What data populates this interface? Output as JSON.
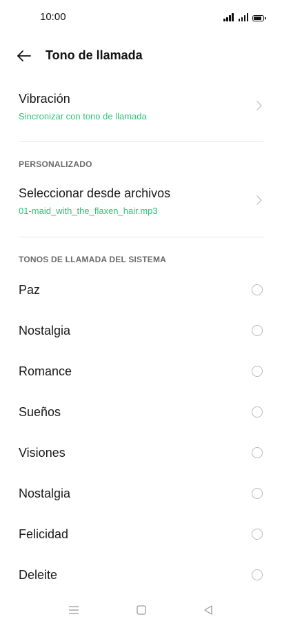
{
  "status_bar": {
    "time": "10:00",
    "icons": [
      "signal-icon",
      "signal-icon",
      "battery-icon"
    ]
  },
  "header": {
    "back_icon": "arrow-left-icon",
    "title": "Tono de llamada"
  },
  "vibration": {
    "title": "Vibración",
    "subtitle": "Sincronizar con tono de llamada"
  },
  "custom_section": {
    "header": "PERSONALIZADO",
    "item_title": "Seleccionar desde archivos",
    "item_subtitle": "01-maid_with_the_flaxen_hair.mp3"
  },
  "system_section": {
    "header": "TONOS DE LLAMADA DEL SISTEMA",
    "tones": [
      {
        "label": "Paz",
        "selected": false
      },
      {
        "label": "Nostalgia",
        "selected": false
      },
      {
        "label": "Romance",
        "selected": false
      },
      {
        "label": "Sueños",
        "selected": false
      },
      {
        "label": "Visiones",
        "selected": false
      },
      {
        "label": "Nostalgia",
        "selected": false
      },
      {
        "label": "Felicidad",
        "selected": false
      },
      {
        "label": "Deleite",
        "selected": false
      }
    ]
  },
  "nav_bar": {
    "buttons": [
      "menu-icon",
      "home-square-icon",
      "back-triangle-icon"
    ]
  },
  "colors": {
    "accent": "#2cc47a",
    "text": "#1a1a1a",
    "section_header": "#6b6b6b",
    "divider": "#e6e6e6",
    "radio_border": "#b9b9b9"
  }
}
